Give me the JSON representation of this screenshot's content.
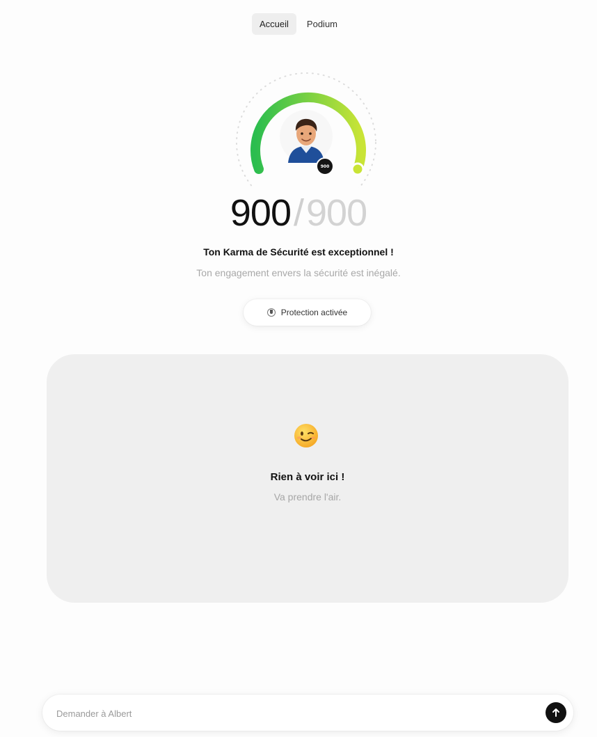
{
  "nav": {
    "tabs": [
      {
        "label": "Accueil",
        "active": true
      },
      {
        "label": "Podium",
        "active": false
      }
    ]
  },
  "karma": {
    "score": "900",
    "separator": "/",
    "max": "900",
    "level_fraction": 1.0,
    "gauge_colors": [
      "#2bbd4f",
      "#c9e436"
    ],
    "avatar_badge": "900",
    "headline": "Ton Karma de Sécurité est exceptionnel !",
    "subline": "Ton engagement envers la sécurité est inégalé.",
    "status_pill": {
      "label": "Protection activée",
      "icon": "shield-check-icon"
    }
  },
  "empty_state": {
    "emoji": "winking-face",
    "title": "Rien à voir ici !",
    "subtitle": "Va prendre l'air."
  },
  "ask": {
    "placeholder": "Demander à Albert",
    "send_icon": "arrow-up-icon"
  }
}
